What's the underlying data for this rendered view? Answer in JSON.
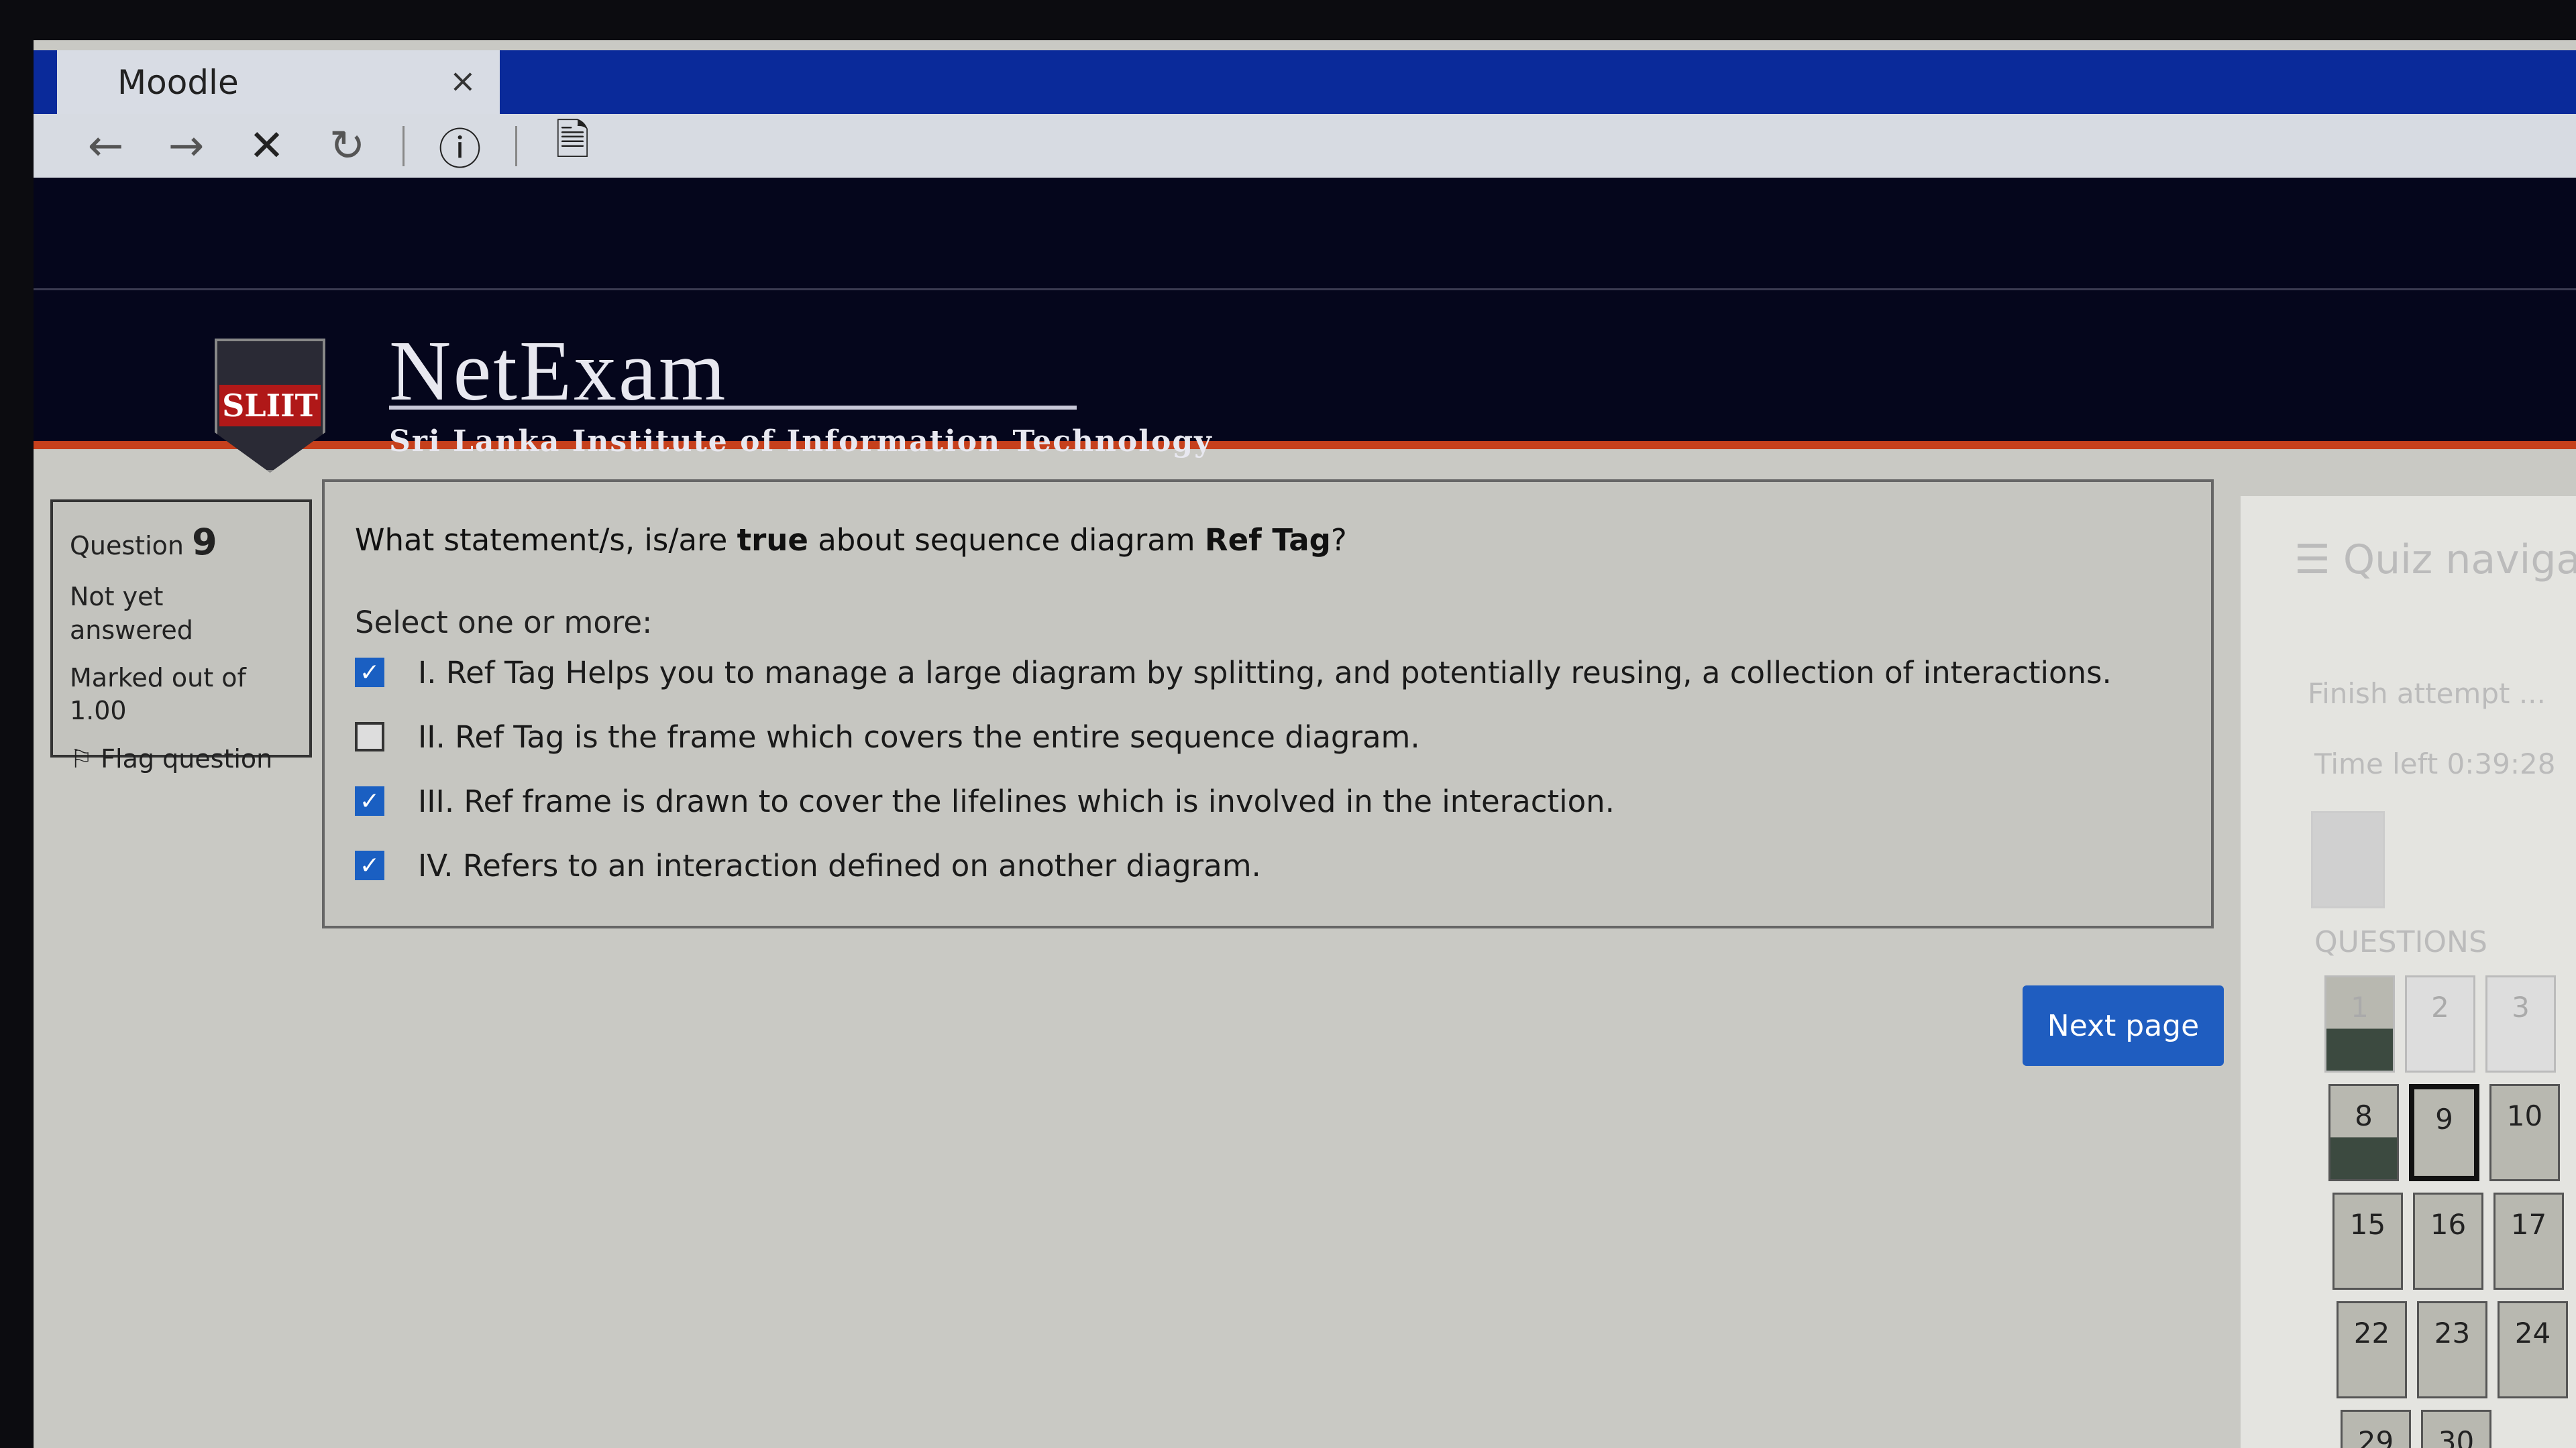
{
  "browser": {
    "tab_title": "Moodle",
    "close": "×",
    "icons": [
      "back-arrow-icon",
      "forward-arrow-icon",
      "stop-icon",
      "reload-icon",
      "info-icon",
      "document-icon"
    ]
  },
  "header": {
    "logo_text": "SLIIT",
    "title": "NetExam",
    "subtitle": "Sri Lanka Institute of Information Technology",
    "accent": "#c6401c"
  },
  "question_info": {
    "label": "Question",
    "number": "9",
    "state": "Not yet answered",
    "marked": "Marked out of",
    "mark": "1.00",
    "flag": "Flag question"
  },
  "question": {
    "pre": "What statement/s, is/are ",
    "bold1": "true",
    "mid": " about sequence diagram ",
    "bold2": "Ref Tag",
    "post": "?",
    "prompt": "Select one or more:",
    "options": [
      {
        "label": "I. Ref Tag Helps you to manage a large diagram by splitting, and potentially reusing, a collection of interactions.",
        "checked": true
      },
      {
        "label": "II. Ref Tag is the frame which covers the entire sequence diagram.",
        "checked": false
      },
      {
        "label": "III. Ref frame is drawn to cover the lifelines which is involved in the interaction.",
        "checked": true
      },
      {
        "label": "IV. Refers to an interaction defined on another diagram.",
        "checked": true
      }
    ]
  },
  "next_button": "Next page",
  "nav": {
    "title": "☰ Quiz navigat",
    "finish": "Finish attempt ...",
    "time": "Time left 0:39:28",
    "questions_label": "QUESTIONS",
    "buttons": [
      {
        "n": "1",
        "answered": true
      },
      {
        "n": "2"
      },
      {
        "n": "3"
      },
      {
        "n": "8",
        "answered": true
      },
      {
        "n": "9",
        "current": true
      },
      {
        "n": "10"
      },
      {
        "n": "15"
      },
      {
        "n": "16"
      },
      {
        "n": "17"
      },
      {
        "n": "22"
      },
      {
        "n": "23"
      },
      {
        "n": "24"
      },
      {
        "n": "29"
      },
      {
        "n": "30"
      }
    ]
  }
}
